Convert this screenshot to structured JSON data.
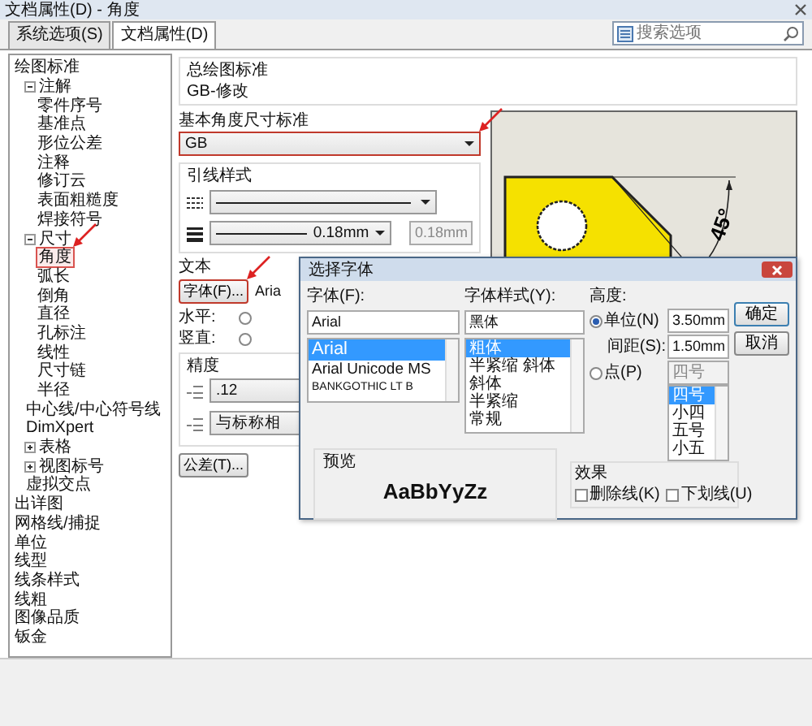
{
  "window": {
    "title": "文档属性(D) - 角度"
  },
  "tabs": [
    {
      "label": "系统选项(S)",
      "selected": false
    },
    {
      "label": "文档属性(D)",
      "selected": true
    }
  ],
  "search": {
    "placeholder": "搜索选项"
  },
  "tree": [
    {
      "label": "绘图标准",
      "selected": false,
      "children": [
        {
          "label": "注解",
          "selected": false,
          "expanded": true,
          "children": [
            {
              "label": "零件序号",
              "selected": false
            },
            {
              "label": "基准点",
              "selected": false
            },
            {
              "label": "形位公差",
              "selected": false
            },
            {
              "label": "注释",
              "selected": false
            },
            {
              "label": "修订云",
              "selected": false
            },
            {
              "label": "表面粗糙度",
              "selected": false
            },
            {
              "label": "焊接符号",
              "selected": false
            }
          ]
        },
        {
          "label": "尺寸",
          "selected": false,
          "expanded": true,
          "children": [
            {
              "label": "角度",
              "selected": true
            },
            {
              "label": "弧长",
              "selected": false
            },
            {
              "label": "倒角",
              "selected": false
            },
            {
              "label": "直径",
              "selected": false
            },
            {
              "label": "孔标注",
              "selected": false
            },
            {
              "label": "线性",
              "selected": false
            },
            {
              "label": "尺寸链",
              "selected": false
            },
            {
              "label": "半径",
              "selected": false
            }
          ]
        },
        {
          "label": "中心线/中心符号线",
          "selected": false
        },
        {
          "label": "DimXpert",
          "selected": false
        },
        {
          "label": "表格",
          "selected": false,
          "expanded": false
        },
        {
          "label": "视图标号",
          "selected": false,
          "expanded": false
        },
        {
          "label": "虚拟交点",
          "selected": false
        }
      ]
    },
    {
      "label": "出详图",
      "selected": false
    },
    {
      "label": "网格线/捕捉",
      "selected": false
    },
    {
      "label": "单位",
      "selected": false
    },
    {
      "label": "线型",
      "selected": false
    },
    {
      "label": "线条样式",
      "selected": false
    },
    {
      "label": "线粗",
      "selected": false
    },
    {
      "label": "图像品质",
      "selected": false
    },
    {
      "label": "钣金",
      "selected": false
    }
  ],
  "overall_standard": {
    "label": "总绘图标准",
    "value": "GB-修改"
  },
  "angle_standard": {
    "label": "基本角度尺寸标准",
    "value": "GB",
    "highlighted": true
  },
  "leader_style": {
    "label": "引线样式",
    "thickness": "0.18mm",
    "custom_thickness": {
      "value": "0.18mm",
      "disabled": true
    }
  },
  "text": {
    "label": "文本",
    "font_button": "字体(F)...",
    "highlighted": true,
    "font_name": "Aria",
    "horizontal_label": "水平:",
    "vertical_label": "竖直:",
    "horizontal_option": {
      "selected": false
    },
    "vertical_option": {
      "selected": false
    }
  },
  "precision": {
    "label": "精度",
    "primary": ".12",
    "tolerance": "与标称相"
  },
  "tolerance_button": "公差(T)...",
  "preview": {
    "dimension": "45°"
  },
  "font_dialog": {
    "title": "选择字体",
    "font_label": "字体(F):",
    "font_value": "Arial",
    "fonts": [
      {
        "label": "Arial",
        "selected": true
      },
      {
        "label": "Arial Unicode MS",
        "selected": false
      },
      {
        "label": "BANKGOTHIC LT B",
        "selected": false
      }
    ],
    "style_label": "字体样式(Y):",
    "style_value": "黑体",
    "styles": [
      {
        "label": "粗体",
        "selected": true
      },
      {
        "label": "半紧缩 斜体",
        "selected": false
      },
      {
        "label": "斜体",
        "selected": false
      },
      {
        "label": "半紧缩",
        "selected": false
      },
      {
        "label": "常规",
        "selected": false
      }
    ],
    "height_label": "高度:",
    "units": {
      "label": "单位(N)",
      "selected": true,
      "value": "3.50mm"
    },
    "spacing": {
      "label": "间距(S):",
      "value": "1.50mm"
    },
    "points": {
      "label": "点(P)",
      "selected": false,
      "value": "四号"
    },
    "sizes": [
      {
        "label": "四号",
        "selected": true
      },
      {
        "label": "小四",
        "selected": false
      },
      {
        "label": "五号",
        "selected": false
      },
      {
        "label": "小五",
        "selected": false
      }
    ],
    "ok": "确定",
    "cancel": "取消",
    "preview_label": "预览",
    "preview_text": "AaBbYyZz",
    "effects_label": "效果",
    "effects": [
      {
        "label": "删除线(K)",
        "checked": false
      },
      {
        "label": "下划线(U)",
        "checked": false
      }
    ]
  }
}
